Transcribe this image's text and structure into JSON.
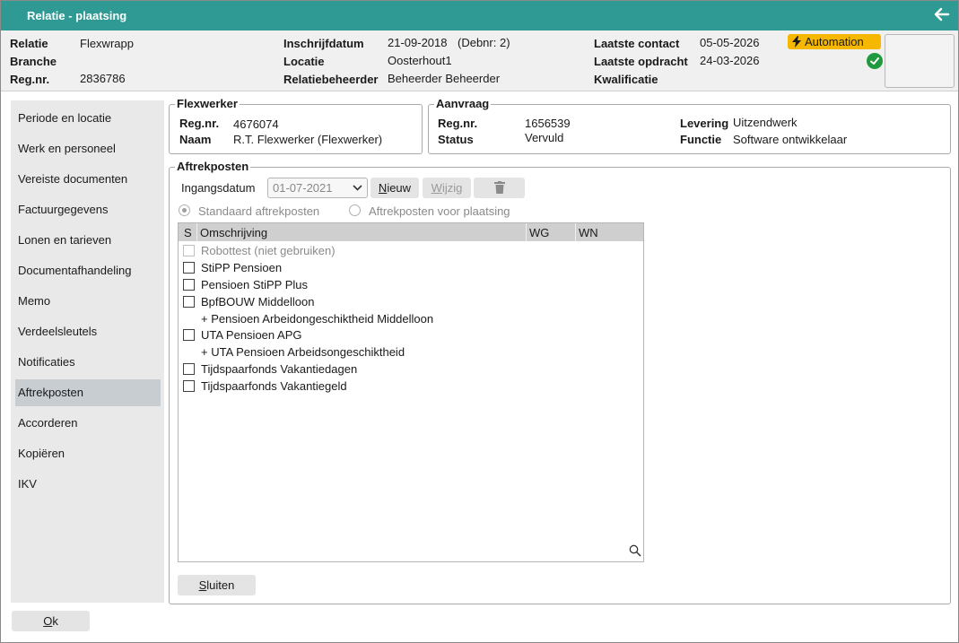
{
  "window": {
    "title": "Relatie - plaatsing"
  },
  "header": {
    "relatie_label": "Relatie",
    "relatie_value": "Flexwrapp",
    "branche_label": "Branche",
    "branche_value": "",
    "regnr_label": "Reg.nr.",
    "regnr_value": "2836786",
    "inschrijfdatum_label": "Inschrijfdatum",
    "inschrijfdatum_value": "21-09-2018",
    "debnr": "(Debnr: 2)",
    "locatie_label": "Locatie",
    "locatie_value": "Oosterhout1",
    "relatiebeheerder_label": "Relatiebeheerder",
    "relatiebeheerder_value": "Beheerder Beheerder",
    "laatste_contact_label": "Laatste contact",
    "laatste_contact_value": "05-05-2026",
    "laatste_opdracht_label": "Laatste opdracht",
    "laatste_opdracht_value": "24-03-2026",
    "kwalificatie_label": "Kwalificatie",
    "kwalificatie_value": "",
    "automation_badge": "Automation"
  },
  "sidebar": {
    "items": [
      {
        "label": "Periode en locatie"
      },
      {
        "label": "Werk en personeel"
      },
      {
        "label": "Vereiste documenten"
      },
      {
        "label": "Factuurgegevens"
      },
      {
        "label": "Lonen en tarieven"
      },
      {
        "label": "Documentafhandeling"
      },
      {
        "label": "Memo"
      },
      {
        "label": "Verdeelsleutels"
      },
      {
        "label": "Notificaties"
      },
      {
        "label": "Aftrekposten"
      },
      {
        "label": "Accorderen"
      },
      {
        "label": "Kopiëren"
      },
      {
        "label": "IKV"
      }
    ],
    "active_index": 9
  },
  "flexwerker": {
    "legend": "Flexwerker",
    "regnr_label": "Reg.nr.",
    "regnr_value": "4676074",
    "naam_label": "Naam",
    "naam_value": "R.T. Flexwerker (Flexwerker)"
  },
  "aanvraag": {
    "legend": "Aanvraag",
    "regnr_label": "Reg.nr.",
    "regnr_value": "1656539",
    "status_label": "Status",
    "status_value": "Vervuld",
    "levering_label": "Levering",
    "levering_value": "Uitzendwerk",
    "functie_label": "Functie",
    "functie_value": "Software ontwikkelaar"
  },
  "aftrekposten": {
    "legend": "Aftrekposten",
    "ingangsdatum_label": "Ingangsdatum",
    "ingangsdatum_value": "01-07-2021",
    "nieuw_prefix": "N",
    "nieuw_rest": "ieuw",
    "wijzig_prefix": "W",
    "wijzig_rest": "ijzig",
    "radio_standaard": "Standaard aftrekposten",
    "radio_plaatsing": "Aftrekposten voor plaatsing",
    "columns": {
      "s": "S",
      "omschrijving": "Omschrijving",
      "wg": "WG",
      "wn": "WN"
    },
    "rows": [
      {
        "text": "Robottest (niet gebruiken)",
        "checkbox": true,
        "disabled": true
      },
      {
        "text": "StiPP Pensioen",
        "checkbox": true,
        "disabled": false
      },
      {
        "text": "Pensioen StiPP Plus",
        "checkbox": true,
        "disabled": false
      },
      {
        "text": "BpfBOUW Middelloon",
        "checkbox": true,
        "disabled": false
      },
      {
        "text": "+ Pensioen Arbeidongeschiktheid Middelloon",
        "checkbox": false,
        "disabled": false
      },
      {
        "text": "UTA Pensioen APG",
        "checkbox": true,
        "disabled": false
      },
      {
        "text": "+ UTA Pensioen Arbeidsongeschiktheid",
        "checkbox": false,
        "disabled": false
      },
      {
        "text": "Tijdspaarfonds Vakantiedagen",
        "checkbox": true,
        "disabled": false
      },
      {
        "text": "Tijdspaarfonds Vakantiegeld",
        "checkbox": true,
        "disabled": false
      }
    ],
    "sluiten_prefix": "S",
    "sluiten_rest": "luiten"
  },
  "footer": {
    "ok_prefix": "O",
    "ok_rest": "k"
  },
  "colors": {
    "titlebar": "#2e9a93",
    "badge": "#f5b700",
    "ok": "#1f9a3e",
    "active_nav": "#c8cdd2"
  }
}
